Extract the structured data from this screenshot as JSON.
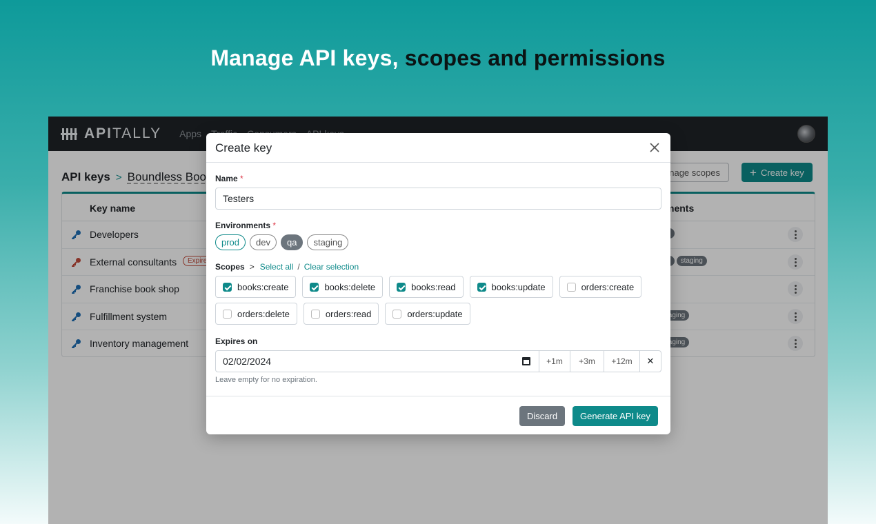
{
  "headline": {
    "part1": "Manage API keys",
    "comma": ", ",
    "part2": "scopes and permissions"
  },
  "app": {
    "logo_a": "API",
    "logo_b": "TALLY",
    "nav": [
      "Apps",
      "Traffic",
      "Consumers",
      "API keys"
    ],
    "breadcrumb": {
      "root": "API keys",
      "separator": ">",
      "app": "Boundless Book"
    },
    "manage_scopes_label": "anage scopes",
    "create_key_label": "Create key",
    "table": {
      "col_name": "Key name",
      "col_env": "ments",
      "rows": [
        {
          "name": "Developers",
          "badge": "",
          "envs": [
            "a"
          ]
        },
        {
          "name": "External consultants",
          "badge": "Expire",
          "envs": [
            "a",
            "staging"
          ]
        },
        {
          "name": "Franchise book shop",
          "badge": "",
          "envs": []
        },
        {
          "name": "Fulfillment system",
          "badge": "",
          "envs": [
            "taging"
          ]
        },
        {
          "name": "Inventory management",
          "badge": "",
          "envs": [
            "taging"
          ]
        }
      ]
    }
  },
  "modal": {
    "title": "Create key",
    "name_label": "Name",
    "required_mark": "*",
    "name_value": "Testers",
    "env_label": "Environments",
    "environments": [
      {
        "label": "prod",
        "state": "selected-outline"
      },
      {
        "label": "dev",
        "state": "unselected"
      },
      {
        "label": "qa",
        "state": "selected-filled"
      },
      {
        "label": "staging",
        "state": "unselected"
      }
    ],
    "scopes_label": "Scopes",
    "select_all": "Select all",
    "slash": "/",
    "clear_selection": "Clear selection",
    "scopes": [
      {
        "label": "books:create",
        "checked": true
      },
      {
        "label": "books:delete",
        "checked": true
      },
      {
        "label": "books:read",
        "checked": true
      },
      {
        "label": "books:update",
        "checked": true
      },
      {
        "label": "orders:create",
        "checked": false
      },
      {
        "label": "orders:delete",
        "checked": false
      },
      {
        "label": "orders:read",
        "checked": false
      },
      {
        "label": "orders:update",
        "checked": false
      }
    ],
    "expires_label": "Expires on",
    "expires_value": "02/02/2024",
    "add_1m": "+1m",
    "add_3m": "+3m",
    "add_12m": "+12m",
    "clear_date": "✕",
    "hint": "Leave empty for no expiration.",
    "discard_label": "Discard",
    "generate_label": "Generate API key"
  },
  "colors": {
    "accent": "#0e8a8a",
    "navbar": "#1f2327",
    "secondary": "#6c757d",
    "danger": "#dc3545"
  }
}
